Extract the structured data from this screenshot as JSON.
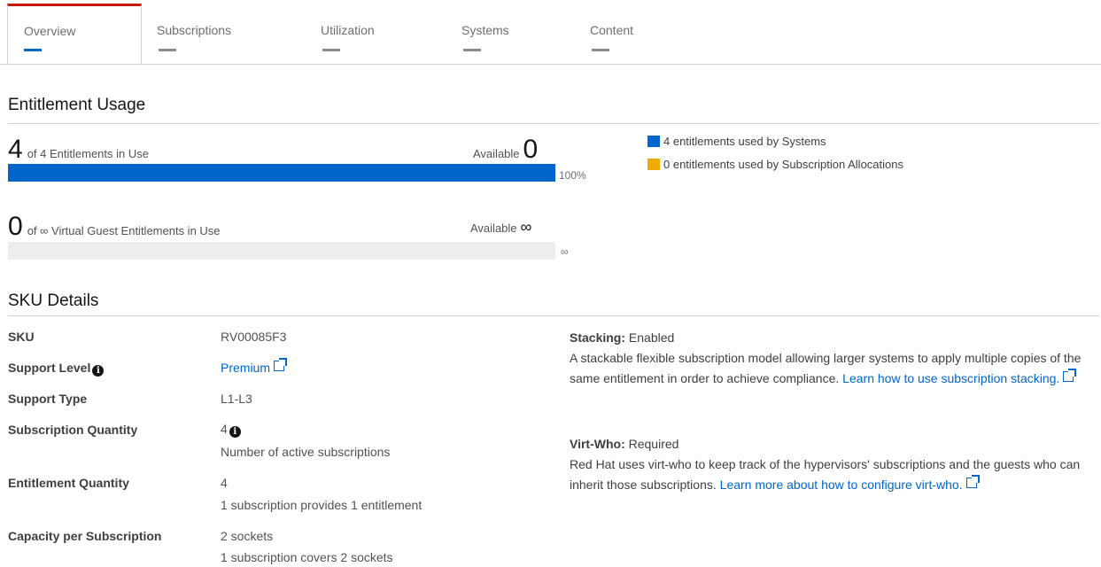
{
  "tabs": [
    {
      "label": "Overview"
    },
    {
      "label": "Subscriptions"
    },
    {
      "label": "Utilization"
    },
    {
      "label": "Systems"
    },
    {
      "label": "Content"
    }
  ],
  "entitlement_usage": {
    "heading": "Entitlement Usage",
    "physical": {
      "used": "4",
      "text": "of 4 Entitlements in Use",
      "available_label": "Available",
      "available": "0",
      "percent_label": "100%",
      "fill_fraction": 1.0
    },
    "virtual": {
      "used": "0",
      "text": "of ∞ Virtual Guest Entitlements in Use",
      "available_label": "Available",
      "available": "∞",
      "percent_label": "∞",
      "fill_fraction": 0
    },
    "legend": [
      {
        "label": "4 entitlements used by Systems",
        "color": "#0066cc"
      },
      {
        "label": "0 entitlements used by Subscription Allocations",
        "color": "#f0ab00"
      }
    ]
  },
  "sku_details": {
    "heading": "SKU Details",
    "sku_label": "SKU",
    "sku": "RV00085F3",
    "support_level_label": "Support Level",
    "support_level": "Premium",
    "support_type_label": "Support Type",
    "support_type": "L1-L3",
    "subscription_quantity_label": "Subscription Quantity",
    "subscription_quantity": "4",
    "subscription_quantity_note": "Number of active subscriptions",
    "entitlement_quantity_label": "Entitlement Quantity",
    "entitlement_quantity": "4",
    "entitlement_quantity_note": "1 subscription provides 1 entitlement",
    "capacity_label": "Capacity per Subscription",
    "capacity": "2 sockets",
    "capacity_note": "1 subscription covers 2 sockets",
    "stacking_label": "Stacking:",
    "stacking_value": "Enabled",
    "stacking_text": "A stackable flexible subscription model allowing larger systems to apply multiple copies of the same entitlement in order to achieve compliance.",
    "stacking_link": "Learn how to use subscription stacking.",
    "virtwho_label": "Virt-Who:",
    "virtwho_value": "Required",
    "virtwho_text": "Red Hat uses virt-who to keep track of the hypervisors' subscriptions and the guests who can inherit those subscriptions.",
    "virtwho_link": "Learn more about how to configure virt-who."
  }
}
